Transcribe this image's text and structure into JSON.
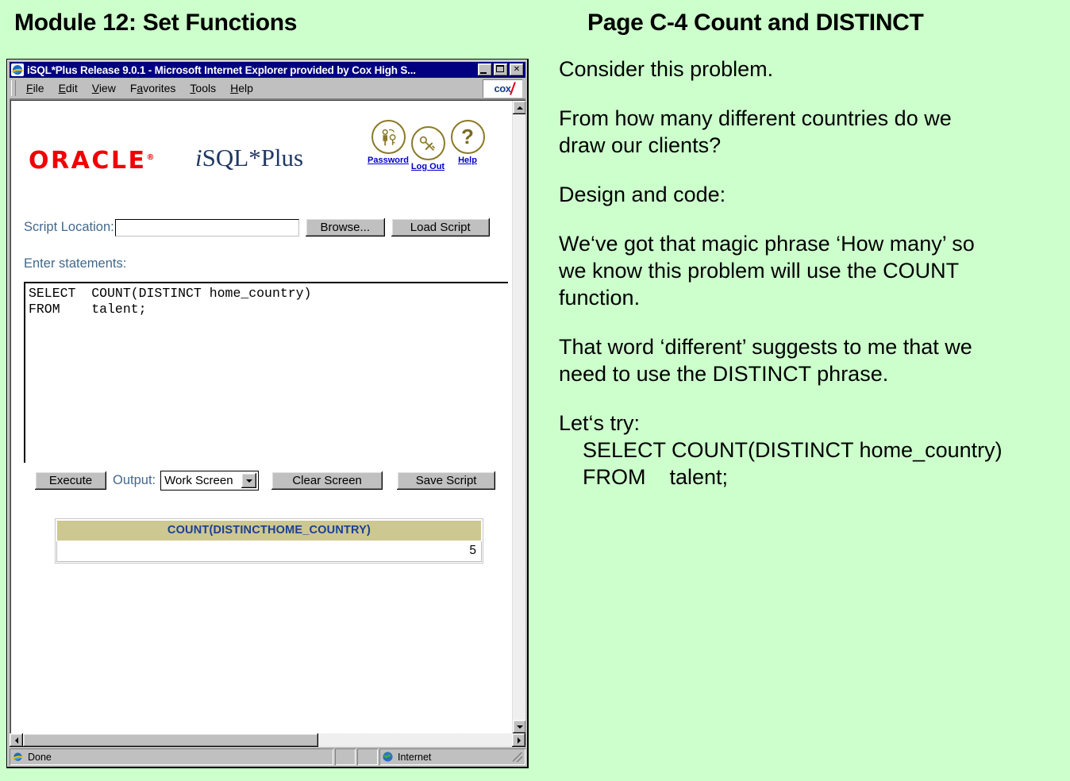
{
  "slide": {
    "title_left": "Module 12: Set Functions",
    "title_right": "Page C-4 Count and DISTINCT"
  },
  "notes": {
    "block1": "Consider this problem.",
    "block2_line1": "From how many different countries do we",
    "block2_line2": "draw our clients?",
    "block3": "Design and code:",
    "block4_line1": "We‘ve got that magic phrase ‘How many’ so",
    "block4_line2": "we know this problem will use the COUNT",
    "block4_line3": "function.",
    "block5_line1": "That word ‘different’ suggests to me that we",
    "block5_line2": "need to use the DISTINCT phrase.",
    "block6_intro": "Let‘s try:",
    "block6_code1": "SELECT COUNT(DISTINCT home_country)",
    "block6_code2": "FROM    talent;"
  },
  "browser": {
    "title": "iSQL*Plus Release 9.0.1 - Microsoft Internet Explorer provided by Cox High S...",
    "window_buttons": {
      "minimize": "minimize-button",
      "maximize": "maximize-button",
      "close": "✕"
    },
    "menus": [
      {
        "pre": "",
        "accel": "F",
        "post": "ile"
      },
      {
        "pre": "",
        "accel": "E",
        "post": "dit"
      },
      {
        "pre": "",
        "accel": "V",
        "post": "iew"
      },
      {
        "pre": "F",
        "accel": "a",
        "post": "vorites"
      },
      {
        "pre": "",
        "accel": "T",
        "post": "ools"
      },
      {
        "pre": "",
        "accel": "H",
        "post": "elp"
      }
    ],
    "brand_logo": "cox",
    "status": {
      "message": "Done",
      "zone": "Internet"
    }
  },
  "page": {
    "oracle_logo": "ORACLE",
    "oracle_tm": "®",
    "product_i": "i",
    "product_rest": "SQL*Plus",
    "icon_links": [
      {
        "label": "Password",
        "icon": "person-key-icon"
      },
      {
        "label": "Log Out",
        "icon": "key-x-icon"
      },
      {
        "label": "Help",
        "icon": "question-mark-icon"
      }
    ],
    "script_location_label": "Script Location:",
    "script_location_value": "",
    "script_location_placeholder": "",
    "browse_button": "Browse...",
    "load_script_button": "Load Script",
    "enter_statements_label": "Enter statements:",
    "sql_text": "SELECT  COUNT(DISTINCT home_country)\nFROM    talent;",
    "execute_button": "Execute",
    "output_label": "Output:",
    "output_selected": "Work Screen",
    "output_options": [
      "Work Screen"
    ],
    "clear_screen_button": "Clear Screen",
    "save_script_button": "Save Script",
    "results": {
      "header": "COUNT(DISTINCTHOME_COUNTRY)",
      "value": "5"
    }
  }
}
